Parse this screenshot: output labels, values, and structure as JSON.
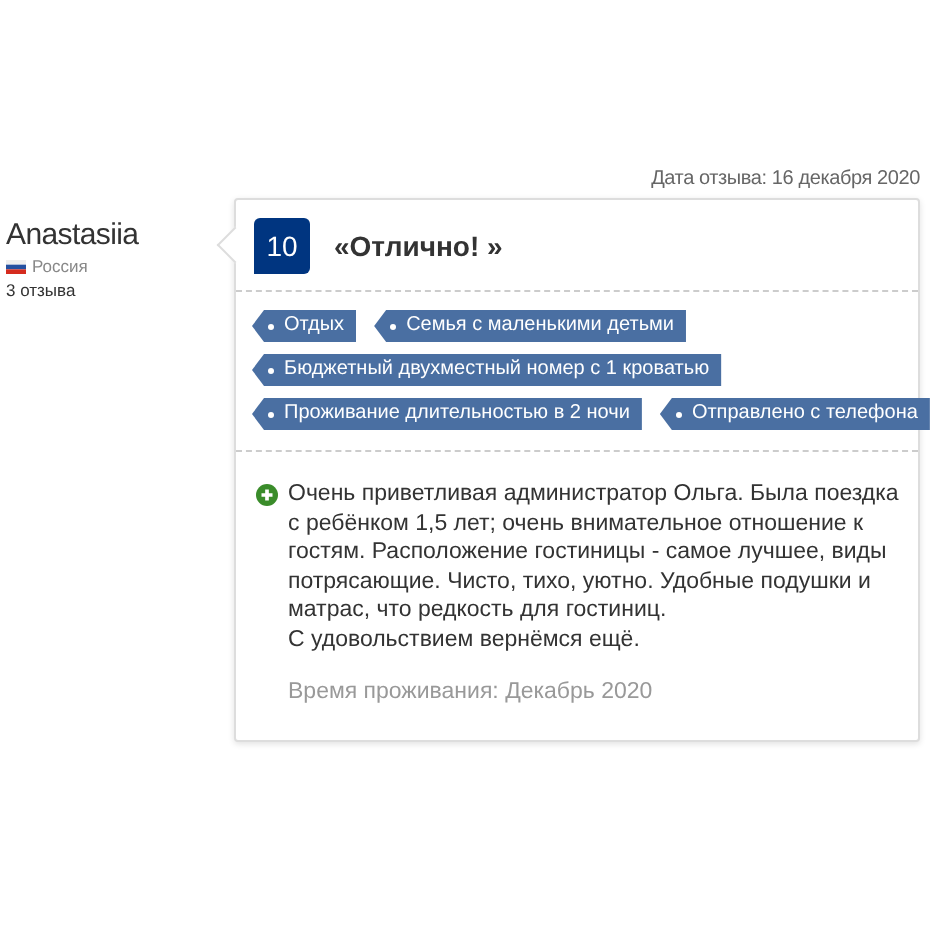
{
  "review_date": "Дата отзыва: 16 декабря 2020",
  "reviewer": {
    "name": "Anastasiia",
    "country": "Россия",
    "reviews": "3 отзыва"
  },
  "score": "10",
  "title": "«Отлично! »",
  "tag_rows": [
    [
      "Отдых",
      "Семья с маленькими детьми"
    ],
    [
      "Бюджетный двухместный номер с 1 кроватью"
    ],
    [
      "Проживание длительностью в 2 ночи",
      "Отправлено с телефона"
    ]
  ],
  "positive": [
    "Очень приветливая администратор Ольга. Была поездка с ребёнком 1,5 лет; очень внимательное отношение к гостям. Расположение гостиницы - самое лучшее, виды потрясающие. Чисто, тихо, уютно. Удобные подушки и матрас, что редкость для гостиниц.",
    "С удовольствием вернёмся ещё."
  ],
  "stay": "Время проживания: Декабрь 2020"
}
